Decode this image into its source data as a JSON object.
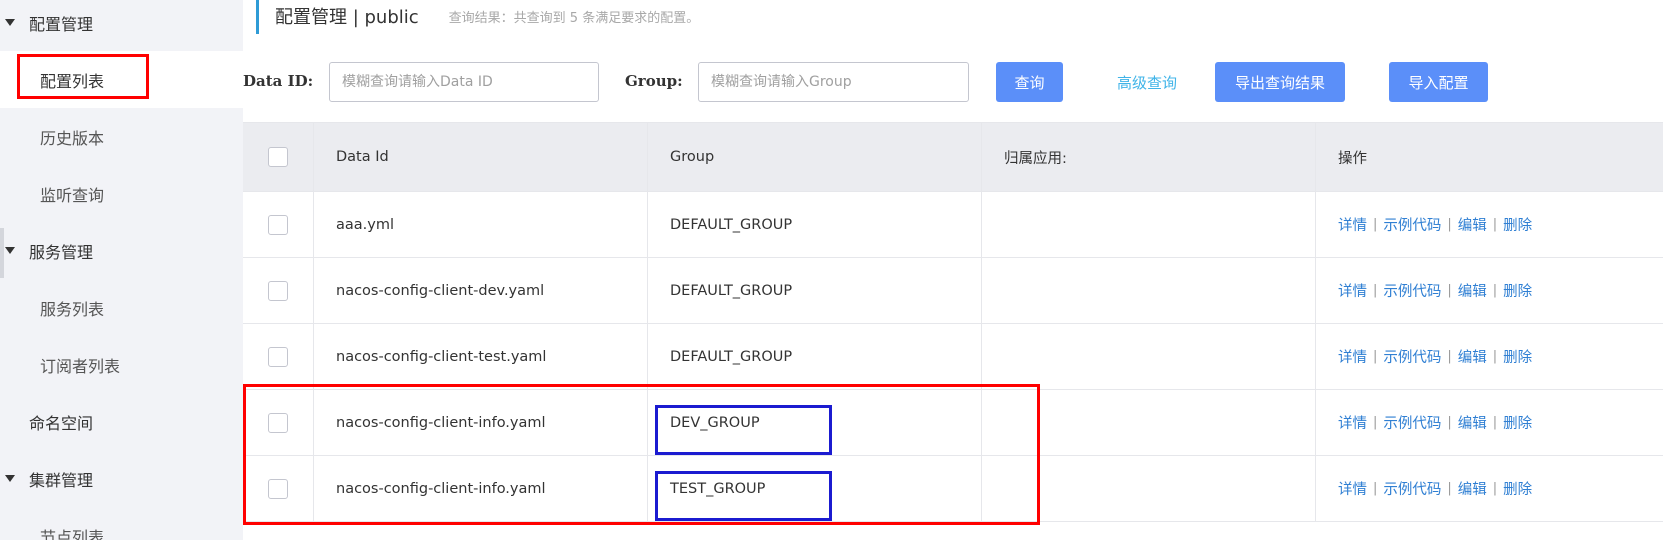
{
  "sidebar": {
    "items": [
      {
        "label": "配置管理",
        "type": "group"
      },
      {
        "label": "配置列表",
        "type": "child",
        "active": true
      },
      {
        "label": "历史版本",
        "type": "child"
      },
      {
        "label": "监听查询",
        "type": "child"
      },
      {
        "label": "服务管理",
        "type": "group"
      },
      {
        "label": "服务列表",
        "type": "child"
      },
      {
        "label": "订阅者列表",
        "type": "child"
      },
      {
        "label": "命名空间",
        "type": "top"
      },
      {
        "label": "集群管理",
        "type": "group"
      },
      {
        "label": "节点列表",
        "type": "child"
      }
    ]
  },
  "header": {
    "title": "配置管理 | public",
    "subtitle": "查询结果：共查询到 5 条满足要求的配置。"
  },
  "search": {
    "data_id_label": "Data ID:",
    "data_id_placeholder": "模糊查询请输入Data ID",
    "group_label": "Group:",
    "group_placeholder": "模糊查询请输入Group",
    "query_button": "查询",
    "advanced_link": "高级查询",
    "export_button": "导出查询结果",
    "import_button": "导入配置"
  },
  "table": {
    "columns": [
      "Data Id",
      "Group",
      "归属应用:",
      "操作"
    ],
    "rows": [
      {
        "data_id": "aaa.yml",
        "group": "DEFAULT_GROUP",
        "app": ""
      },
      {
        "data_id": "nacos-config-client-dev.yaml",
        "group": "DEFAULT_GROUP",
        "app": ""
      },
      {
        "data_id": "nacos-config-client-test.yaml",
        "group": "DEFAULT_GROUP",
        "app": ""
      },
      {
        "data_id": "nacos-config-client-info.yaml",
        "group": "DEV_GROUP",
        "app": ""
      },
      {
        "data_id": "nacos-config-client-info.yaml",
        "group": "TEST_GROUP",
        "app": ""
      }
    ],
    "actions": [
      "详情",
      "示例代码",
      "编辑",
      "删除"
    ],
    "action_separator": "|"
  },
  "colors": {
    "primary_button": "#5b8ff9",
    "link": "#2f7fd3",
    "highlight_red": "#ff0000",
    "highlight_blue": "#1b1bd0",
    "sidebar_bg": "#f2f3f7"
  }
}
